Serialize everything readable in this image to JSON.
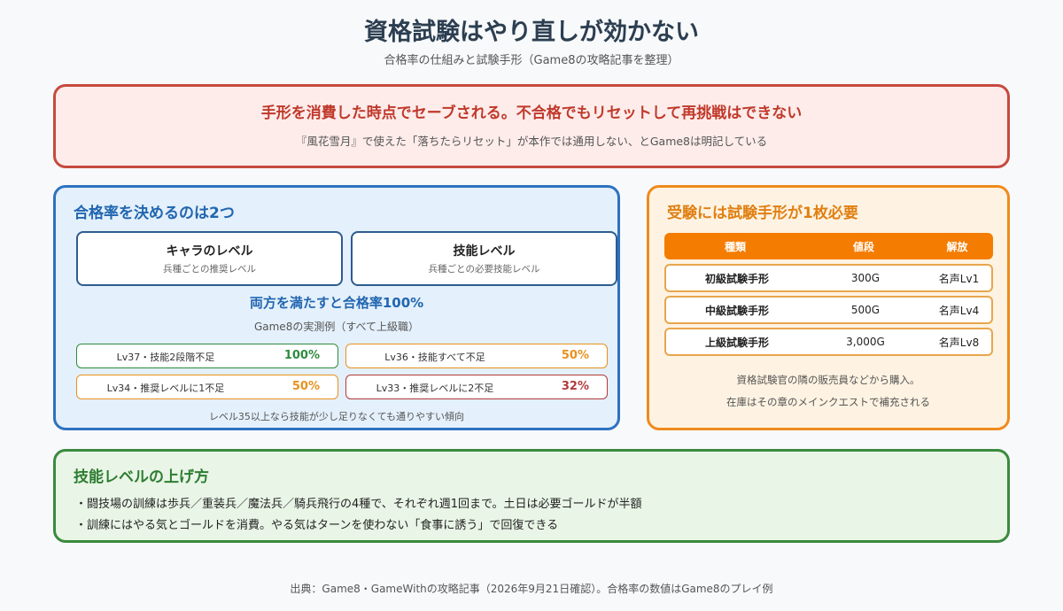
{
  "header": {
    "title": "資格試験はやり直しが効かない",
    "subtitle": "合格率の仕組みと試験手形（Game8の攻略記事を整理）"
  },
  "warning": {
    "title": "手形を消費した時点でセーブされる。不合格でもリセットして再挑戦はできない",
    "subtitle": "『風花雪月』で使えた「落ちたらリセット」が本作では通用しない、とGame8は明記している"
  },
  "pass_rate": {
    "heading": "合格率を決めるのは2つ",
    "factors": [
      {
        "name": "キャラのレベル",
        "desc": "兵種ごとの推奨レベル"
      },
      {
        "name": "技能レベル",
        "desc": "兵種ごとの必要技能レベル"
      }
    ],
    "both_line": "両方を満たすと合格率100%",
    "examples_label": "Game8の実測例（すべて上級職）",
    "examples": [
      {
        "label": "Lv37・技能2段階不足",
        "rate": "100%",
        "level": 1.0
      },
      {
        "label": "Lv36・技能すべて不足",
        "rate": "50%",
        "level": 0.5
      },
      {
        "label": "Lv34・推奨レベルに1不足",
        "rate": "50%",
        "level": 0.5
      },
      {
        "label": "Lv33・推奨レベルに2不足",
        "rate": "32%",
        "level": 0.32
      }
    ],
    "note": "レベル35以上なら技能が少し足りなくても通りやすい傾向"
  },
  "seals": {
    "heading": "受験には試験手形が1枚必要",
    "columns": [
      "種類",
      "値段",
      "解放"
    ],
    "rows": [
      {
        "name": "初級試験手形",
        "price": "300G",
        "unlock": "名声Lv1"
      },
      {
        "name": "中級試験手形",
        "price": "500G",
        "unlock": "名声Lv4"
      },
      {
        "name": "上級試験手形",
        "price": "3,000G",
        "unlock": "名声Lv8"
      }
    ],
    "note1": "資格試験官の隣の販売員などから購入。",
    "note2": "在庫はその章のメインクエストで補充される"
  },
  "skills": {
    "heading": "技能レベルの上げ方",
    "bullets": [
      "・闘技場の訓練は歩兵／重装兵／魔法兵／騎兵飛行の4種で、それぞれ週1回まで。土日は必要ゴールドが半額",
      "・訓練にはやる気とゴールドを消費。やる気はターンを使わない「食事に誘う」で回復できる"
    ]
  },
  "footer": "出典：Game8・GameWithの攻略記事（2026年9月21日確認）。合格率の数値はGame8のプレイ例",
  "colors": {
    "warning_red": "#c64a3e",
    "blue_accent": "#2e72c0",
    "orange_accent": "#f08a1c",
    "green_accent": "#3b8a3f"
  }
}
